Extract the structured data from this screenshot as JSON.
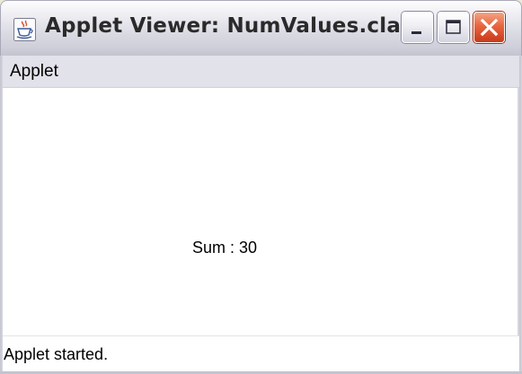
{
  "window": {
    "title": "Applet Viewer: NumValues.class",
    "app_icon": "java-cup-icon",
    "controls": {
      "minimize_icon": "minimize-icon",
      "maximize_icon": "maximize-icon",
      "close_icon": "close-icon"
    }
  },
  "menubar": {
    "items": [
      {
        "label": "Applet"
      }
    ]
  },
  "applet": {
    "output_text": "Sum : 30"
  },
  "statusbar": {
    "text": "Applet started."
  },
  "colors": {
    "close_button": "#e0552f",
    "panel_background": "#ffffff",
    "menubar_background": "#e2e2ea"
  }
}
